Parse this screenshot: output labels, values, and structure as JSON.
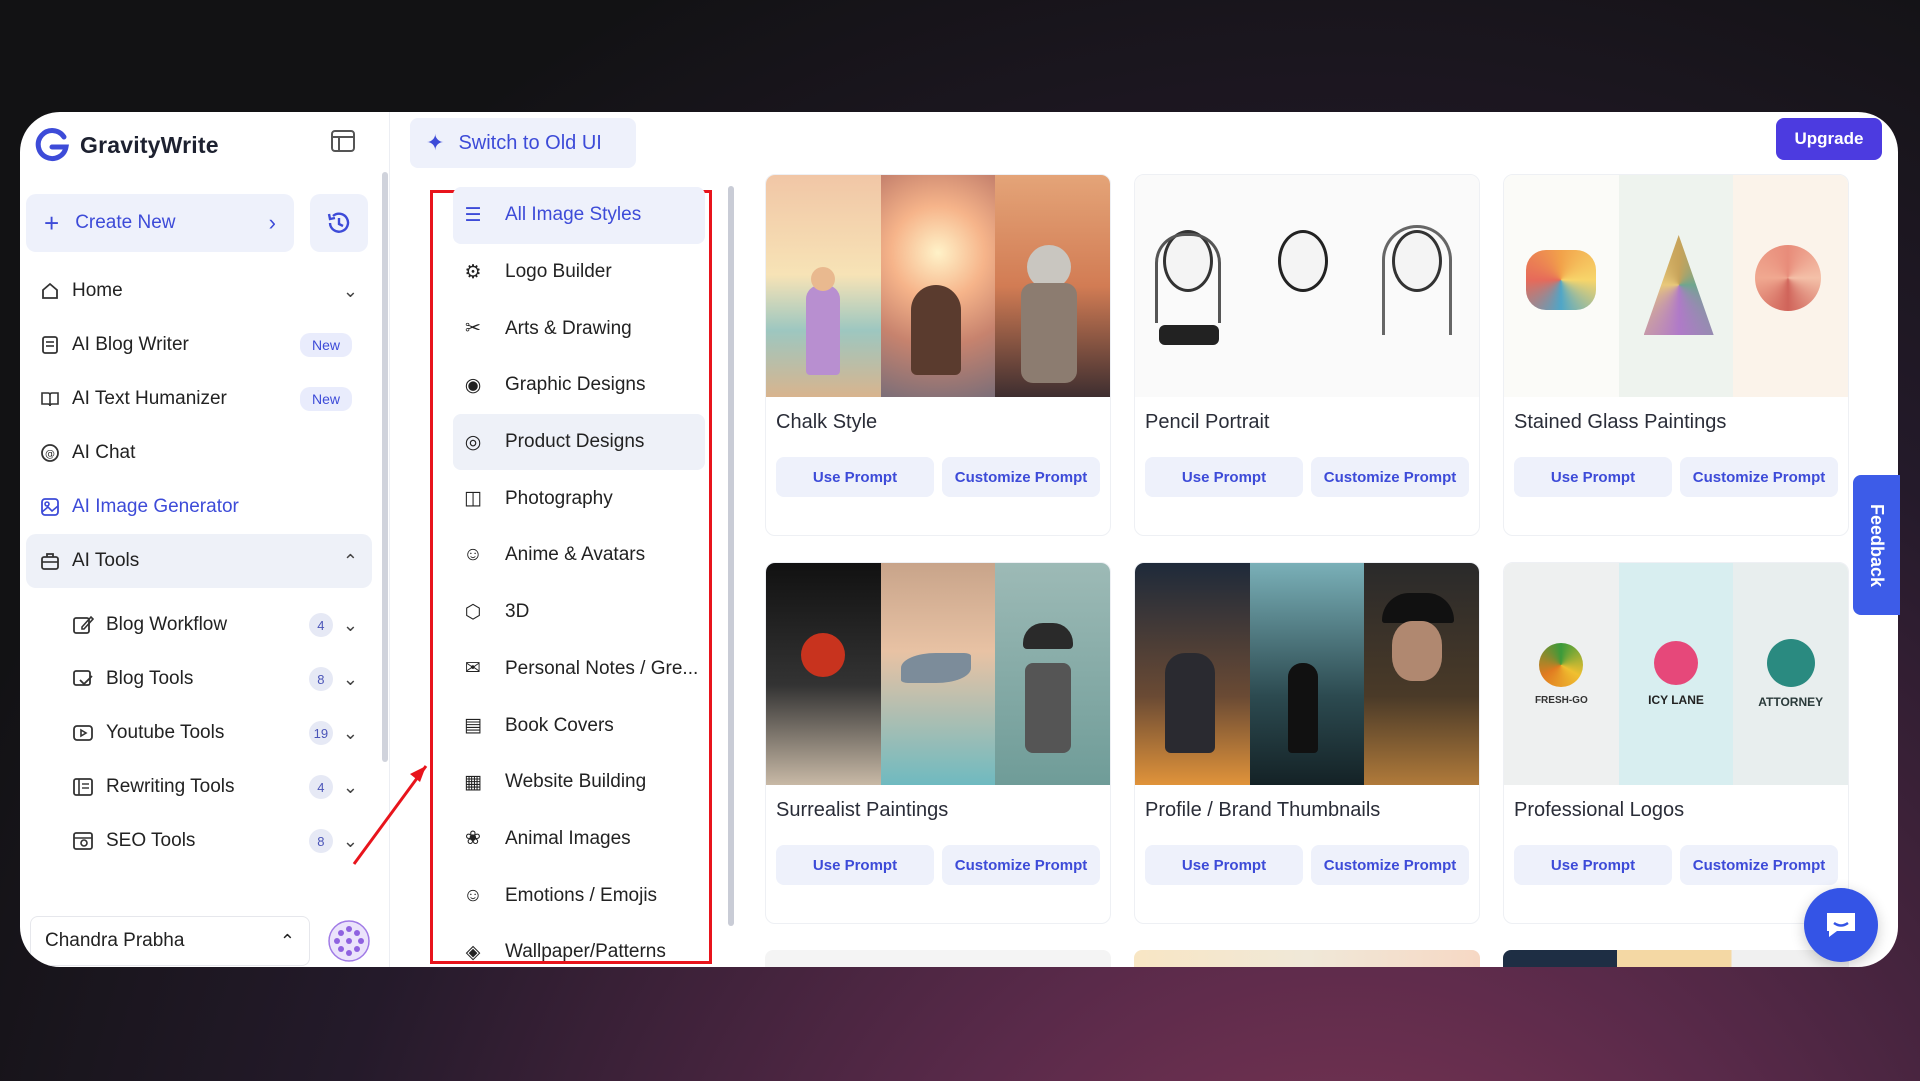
{
  "brand": {
    "name": "GravityWrite"
  },
  "sidebar": {
    "create_new": "Create New",
    "items": [
      {
        "label": "Home",
        "icon": "home-icon"
      },
      {
        "label": "AI Blog Writer",
        "badge": "New",
        "icon": "document-icon"
      },
      {
        "label": "AI Text Humanizer",
        "badge": "New",
        "icon": "book-icon"
      },
      {
        "label": "AI Chat",
        "icon": "chat-icon"
      },
      {
        "label": "AI Image Generator",
        "icon": "image-icon"
      },
      {
        "label": "AI Tools",
        "icon": "briefcase-icon"
      }
    ],
    "tools": [
      {
        "label": "Blog Workflow",
        "count": "4"
      },
      {
        "label": "Blog Tools",
        "count": "8"
      },
      {
        "label": "Youtube Tools",
        "count": "19"
      },
      {
        "label": "Rewriting Tools",
        "count": "4"
      },
      {
        "label": "SEO Tools",
        "count": "8"
      }
    ],
    "user_name": "Chandra Prabha"
  },
  "topbar": {
    "switch_label": "Switch to Old UI",
    "upgrade_label": "Upgrade"
  },
  "styles": [
    {
      "label": "All Image Styles",
      "icon": "list-icon"
    },
    {
      "label": "Logo Builder",
      "icon": "logo-icon"
    },
    {
      "label": "Arts & Drawing",
      "icon": "tools-icon"
    },
    {
      "label": "Graphic Designs",
      "icon": "design-icon"
    },
    {
      "label": "Product Designs",
      "icon": "product-icon"
    },
    {
      "label": "Photography",
      "icon": "camera-icon"
    },
    {
      "label": "Anime & Avatars",
      "icon": "avatar-icon"
    },
    {
      "label": "3D",
      "icon": "cube-icon"
    },
    {
      "label": "Personal Notes / Gre...",
      "icon": "gift-icon"
    },
    {
      "label": "Book Covers",
      "icon": "book-icon"
    },
    {
      "label": "Website Building",
      "icon": "web-icon"
    },
    {
      "label": "Animal Images",
      "icon": "paw-icon"
    },
    {
      "label": "Emotions / Emojis",
      "icon": "smile-icon"
    },
    {
      "label": "Wallpaper/Patterns",
      "icon": "pattern-icon"
    }
  ],
  "cards": [
    {
      "title": "Chalk Style",
      "use": "Use Prompt",
      "customize": "Customize Prompt"
    },
    {
      "title": "Pencil Portrait",
      "use": "Use Prompt",
      "customize": "Customize Prompt"
    },
    {
      "title": "Stained Glass Paintings",
      "use": "Use Prompt",
      "customize": "Customize Prompt"
    },
    {
      "title": "Surrealist Paintings",
      "use": "Use Prompt",
      "customize": "Customize Prompt"
    },
    {
      "title": "Profile / Brand Thumbnails",
      "use": "Use Prompt",
      "customize": "Customize Prompt"
    },
    {
      "title": "Professional Logos",
      "use": "Use Prompt",
      "customize": "Customize Prompt"
    }
  ],
  "logos": [
    "FRESH-GO",
    "ICY LANE",
    "ATTORNEY"
  ],
  "feedback_label": "Feedback",
  "colors": {
    "accent": "#3d4bd8",
    "upgrade": "#4c3be0",
    "highlight": "#e8141c"
  }
}
